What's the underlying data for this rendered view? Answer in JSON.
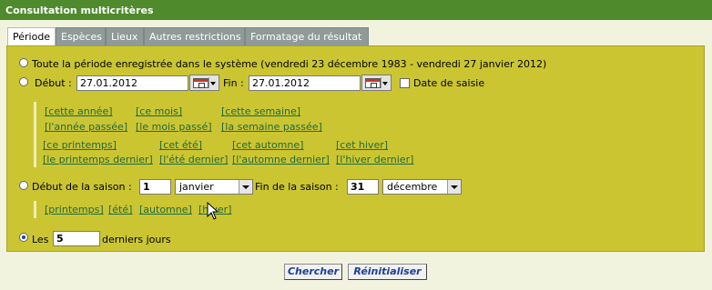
{
  "title": "Consultation multicritères",
  "tabs": [
    "Période",
    "Espèces",
    "Lieux",
    "Autres restrictions",
    "Formatage du résultat"
  ],
  "period": {
    "whole_label": "Toute la période enregistrée dans le système (vendredi 23 décembre 1983 - vendredi 27 janvier 2012)",
    "start_label": "Début :",
    "start_value": "27.01.2012",
    "end_label": "Fin :",
    "end_value": "27.01.2012",
    "entry_date_label": "Date de saisie",
    "links_row1": [
      "[cette année]",
      "[ce mois]",
      "[cette semaine]"
    ],
    "links_row2": [
      "[l'année passée]",
      "[le mois passé]",
      "[la semaine passée]"
    ],
    "links_row3": [
      "[ce printemps]",
      "[cet été]",
      "[cet automne]",
      "[cet hiver]"
    ],
    "links_row4": [
      "[le printemps dernier]",
      "[l'été dernier]",
      "[l'automne dernier]",
      "[l'hiver dernier]"
    ]
  },
  "season": {
    "start_label": "Début de la saison :",
    "start_day": "1",
    "start_month": "janvier",
    "end_label": "Fin de la saison :",
    "end_day": "31",
    "end_month": "décembre",
    "links": [
      "[printemps]",
      "[été]",
      "[automne]",
      "[hiver]"
    ]
  },
  "last_days": {
    "prefix": "Les",
    "value": "5",
    "suffix": "derniers jours"
  },
  "buttons": {
    "search": "Chercher",
    "reset": "Réinitialiser"
  }
}
